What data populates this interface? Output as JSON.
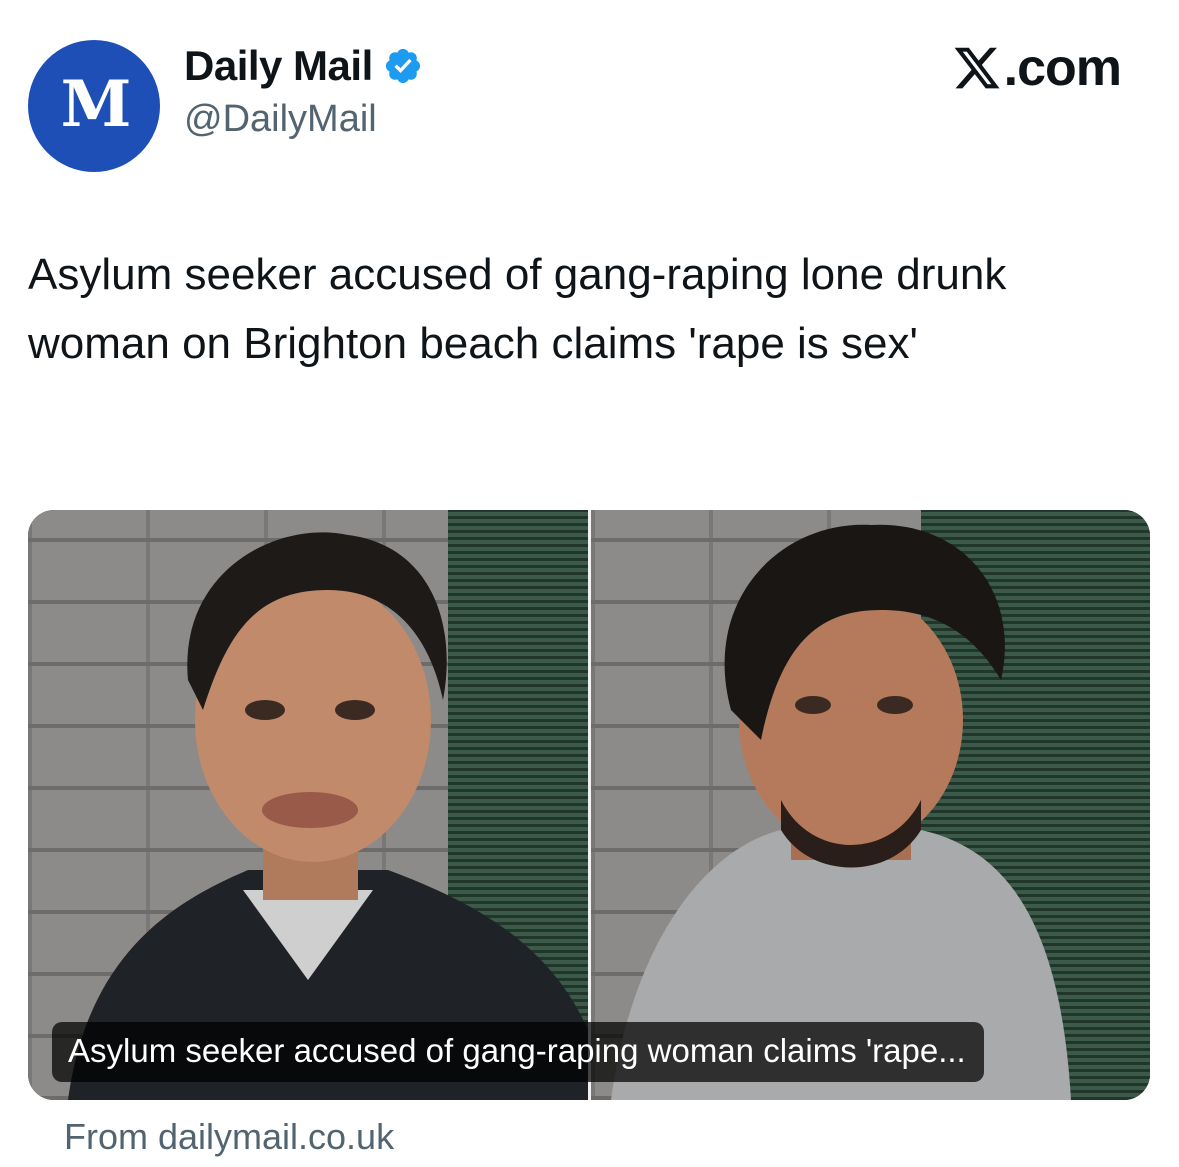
{
  "account": {
    "display_name": "Daily Mail",
    "handle": "@DailyMail",
    "avatar_glyph": "M",
    "avatar_color": "#1d4fb7",
    "verified_icon": "verified-badge-icon",
    "verified_color": "#1d9bf0"
  },
  "site": {
    "label": ".com",
    "logo_icon": "x-logo-icon"
  },
  "tweet": {
    "text": "Asylum seeker accused of gang-raping lone drunk woman on Brighton beach claims 'rape is sex'"
  },
  "card": {
    "caption": "Asylum seeker accused of gang-raping woman claims 'rape...",
    "source": "From dailymail.co.uk"
  }
}
